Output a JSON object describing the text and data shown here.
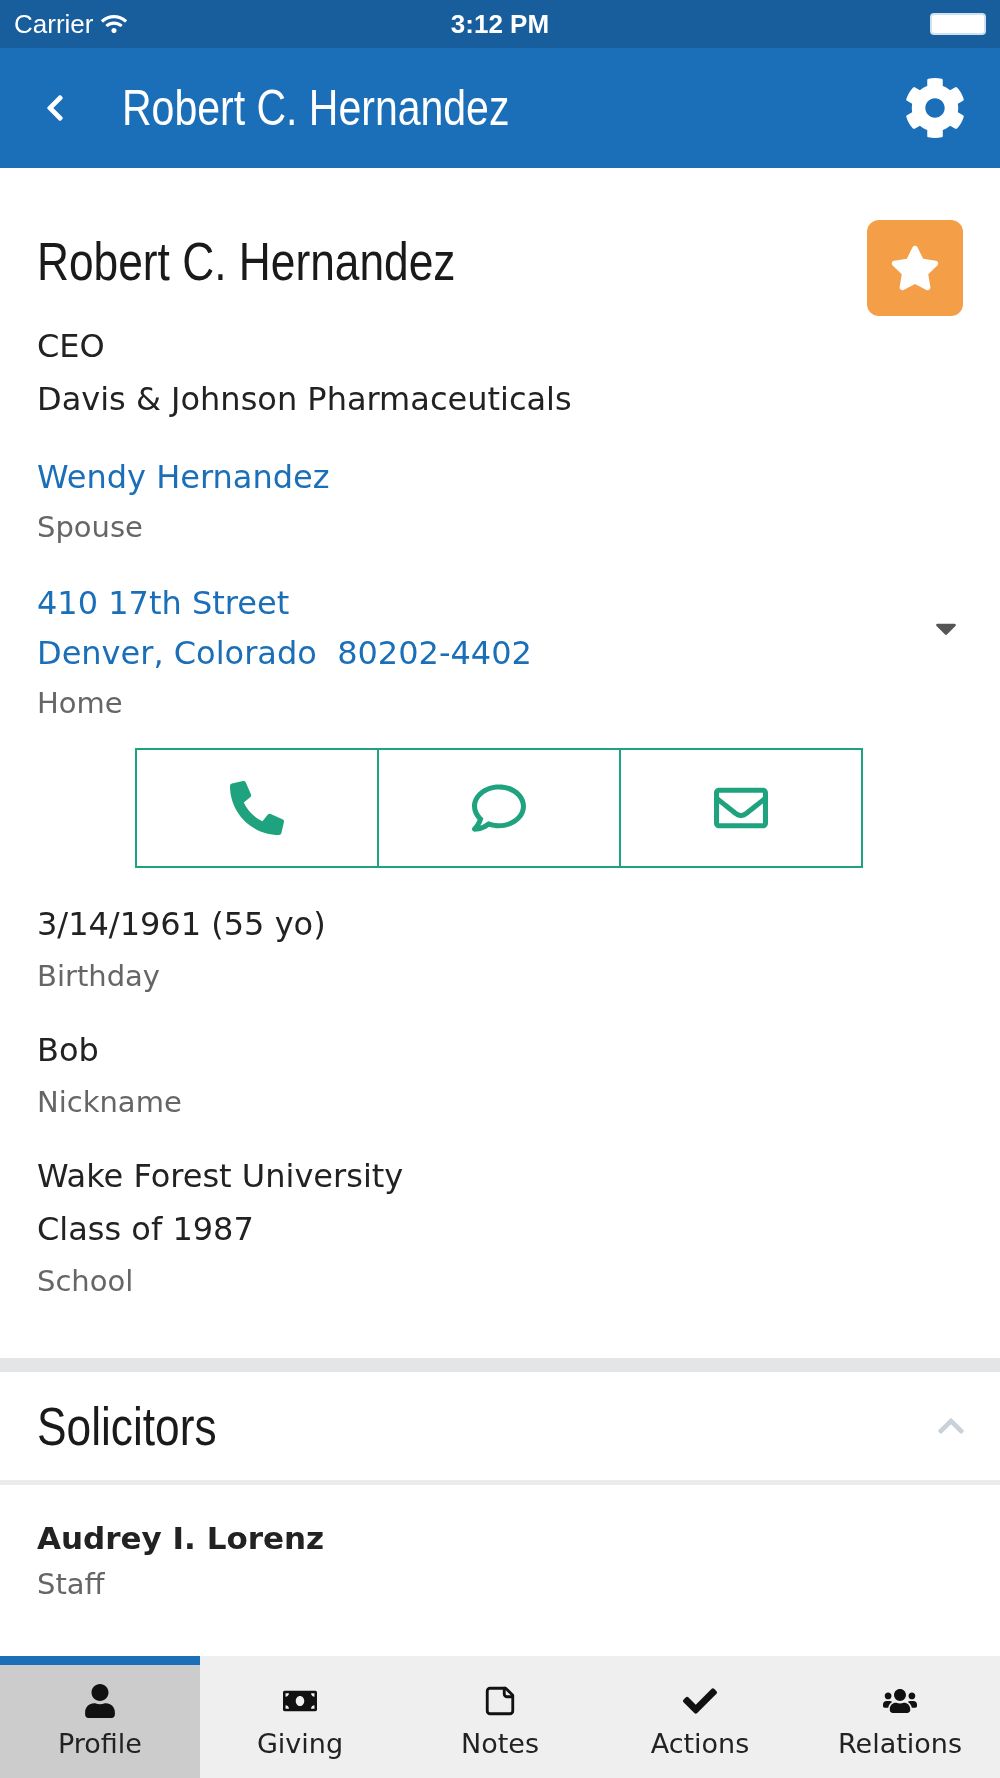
{
  "status_bar": {
    "carrier": "Carrier",
    "time": "3:12 PM"
  },
  "nav": {
    "title": "Robert C. Hernandez"
  },
  "profile": {
    "name": "Robert C. Hernandez",
    "favorite": true,
    "job_title": "CEO",
    "company": "Davis & Johnson Pharmaceuticals",
    "spouse": {
      "name": "Wendy Hernandez",
      "label": "Spouse"
    },
    "address": {
      "lines": [
        "410 17th Street",
        "Denver, Colorado  80202-4402"
      ],
      "label": "Home",
      "expanded": false
    },
    "contact_buttons": [
      {
        "kind": "phone"
      },
      {
        "kind": "message"
      },
      {
        "kind": "email"
      }
    ],
    "fields": [
      {
        "lines": [
          "3/14/1961 (55 yo)"
        ],
        "label": "Birthday"
      },
      {
        "lines": [
          "Bob"
        ],
        "label": "Nickname"
      },
      {
        "lines": [
          "Wake Forest University",
          "Class of 1987"
        ],
        "label": "School"
      }
    ]
  },
  "solicitors": {
    "title": "Solicitors",
    "expanded": true,
    "items": [
      {
        "name": "Audrey I. Lorenz",
        "role": "Staff"
      }
    ]
  },
  "tabs": [
    {
      "label": "Profile",
      "kind": "profile",
      "selected": true
    },
    {
      "label": "Giving",
      "kind": "giving",
      "selected": false
    },
    {
      "label": "Notes",
      "kind": "notes",
      "selected": false
    },
    {
      "label": "Actions",
      "kind": "actions",
      "selected": false
    },
    {
      "label": "Relations",
      "kind": "relations",
      "selected": false
    }
  ]
}
